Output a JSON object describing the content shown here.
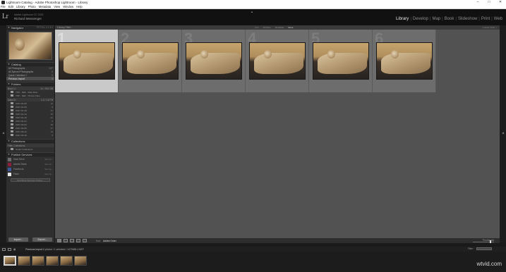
{
  "window": {
    "title": "Lightroom Catalog - Adobe Photoshop Lightroom - Library",
    "controls": [
      "–",
      "□",
      "✕"
    ]
  },
  "menu": [
    "File",
    "Edit",
    "Library",
    "Photo",
    "Metadata",
    "View",
    "Window",
    "Help"
  ],
  "identity": {
    "logo": "Lr",
    "line1": "Adobe Lightroom CC 2015",
    "line2": "Richard Messenger"
  },
  "modules": [
    {
      "label": "Library",
      "active": true
    },
    {
      "label": "Develop",
      "active": false
    },
    {
      "label": "Map",
      "active": false
    },
    {
      "label": "Book",
      "active": false
    },
    {
      "label": "Slideshow",
      "active": false
    },
    {
      "label": "Print",
      "active": false
    },
    {
      "label": "Web",
      "active": false
    }
  ],
  "left_panel": {
    "navigator": {
      "title": "Navigator",
      "options": "FIT  FILL  1:1  3:1"
    },
    "catalog": {
      "title": "Catalog",
      "items": [
        {
          "label": "All Photographs",
          "count": "247",
          "selected": false
        },
        {
          "label": "All Synced Photographs",
          "count": "0",
          "selected": false
        },
        {
          "label": "Quick Collection +",
          "count": "0",
          "selected": false
        },
        {
          "label": "Previous Import",
          "count": "6",
          "selected": true
        }
      ]
    },
    "folders": {
      "title": "Folders",
      "volume1": {
        "label": "Boot C:\\",
        "info": "41 / 931 GB"
      },
      "volume1_items": [
        {
          "label": "TPP - NEF - Raw Files",
          "count": ""
        },
        {
          "label": "TPP - NEF - Picture Files"
        }
      ],
      "volume2": {
        "label": "Data D:\\",
        "info": "1.2 / 1.8 TB"
      },
      "volume2_items": [
        {
          "label": "2017-01-08",
          "count": "12"
        },
        {
          "label": "2017-01-09",
          "count": "8"
        },
        {
          "label": "2017-01-10",
          "count": "31"
        },
        {
          "label": "2017-01-14",
          "count": "15"
        },
        {
          "label": "2017-01-15",
          "count": "22"
        },
        {
          "label": "2017-01-21",
          "count": "9"
        },
        {
          "label": "2017-02-02",
          "count": "18"
        },
        {
          "label": "2017-02-05",
          "count": "27"
        },
        {
          "label": "2017-02-12",
          "count": "14"
        },
        {
          "label": "2017-02-19",
          "count": "6"
        }
      ]
    },
    "collections": {
      "title": "Collections",
      "items": [
        {
          "label": "Filter Collections"
        },
        {
          "label": "Smart Collections"
        }
      ]
    },
    "publish": {
      "title": "Publish Services",
      "items": [
        {
          "label": "Hard Drive",
          "setup": "Set Up...",
          "color": "#6c6c6c"
        },
        {
          "label": "Adobe Stock",
          "setup": "Set Up...",
          "color": "#8c1f3a"
        },
        {
          "label": "Facebook",
          "setup": "Set Up...",
          "color": "#3b5998"
        },
        {
          "label": "Flickr",
          "setup": "Set Up...",
          "color": "#e8e8e8"
        }
      ],
      "find_more": "Find More Services Online..."
    },
    "buttons": {
      "import": "Import...",
      "export": "Export..."
    }
  },
  "filter_bar": {
    "title": "Library Filter :",
    "tabs": [
      {
        "label": "Text",
        "on": false
      },
      {
        "label": "Attribute",
        "on": false
      },
      {
        "label": "Metadata",
        "on": false
      },
      {
        "label": "None",
        "on": true
      }
    ],
    "preset": "Custom Filter ÷"
  },
  "grid": {
    "cells": [
      {
        "num": "1",
        "selected": true
      },
      {
        "num": "2",
        "selected": false
      },
      {
        "num": "3",
        "selected": false
      },
      {
        "num": "4",
        "selected": false
      },
      {
        "num": "5",
        "selected": false
      },
      {
        "num": "6",
        "selected": false
      }
    ]
  },
  "toolbar": {
    "sort_label": "Sort:",
    "sort_value": "Added Order",
    "thumbnails_label": "Thumbnails"
  },
  "filmstrip": {
    "source_prefix": "Previous Import",
    "source_detail": "6 photos /",
    "selection": "1 selected",
    "file": "/ 1479488 4.NEF",
    "filter_label": "Filter :",
    "filter_value": "Filters Off"
  },
  "watermark": "wtvid.com",
  "colors": {
    "accent_active": "#e6e6e6",
    "panel_bg": "#2f2f2f",
    "grid_bg": "#525252",
    "cell_selected": "#c9c9c9"
  }
}
